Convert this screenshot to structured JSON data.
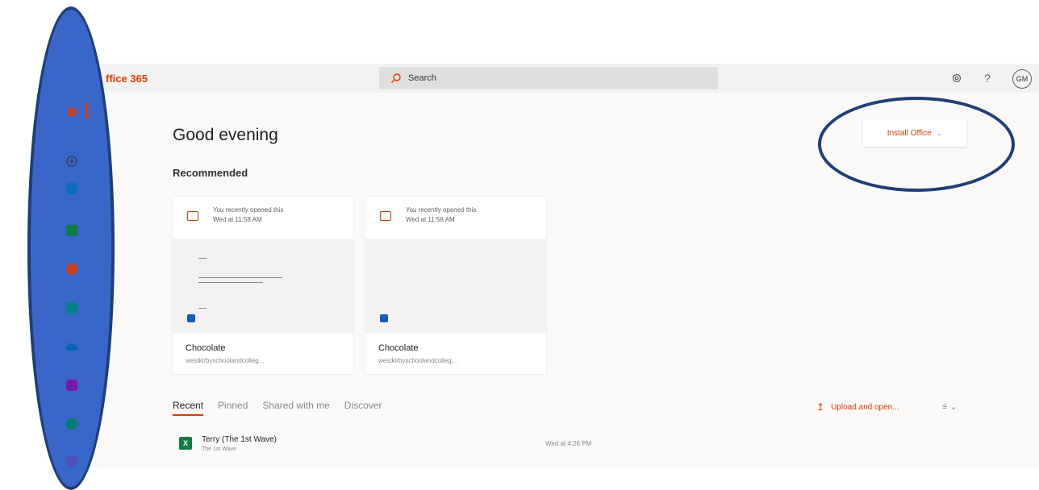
{
  "header": {
    "app_name": "ffice 365",
    "search_placeholder": "Search",
    "avatar_initials": "GM",
    "icons": [
      "waffle-icon",
      "search-icon",
      "gear-icon",
      "help-icon"
    ]
  },
  "rail": {
    "items": [
      {
        "name": "home-icon",
        "color": "#d83b01"
      },
      {
        "name": "create-icon",
        "color": "#605e5c"
      },
      {
        "name": "outlook-icon",
        "color": "#0f6cbd"
      },
      {
        "name": "excel-icon",
        "color": "#107c41"
      },
      {
        "name": "powerpoint-icon",
        "color": "#c43e1c"
      },
      {
        "name": "sharepoint-icon",
        "color": "#038387"
      },
      {
        "name": "onedrive-icon",
        "color": "#0364b8"
      },
      {
        "name": "onenote-icon",
        "color": "#7719aa"
      },
      {
        "name": "sway-icon",
        "color": "#008272"
      },
      {
        "name": "teams-icon",
        "color": "#4b53bc"
      }
    ]
  },
  "main": {
    "greeting": "Good evening",
    "recommended_title": "Recommended",
    "install_office": "Install Office",
    "cards": [
      {
        "line1": "You recently opened this",
        "line2": "Wed at 11:58 AM",
        "name": "Chocolate",
        "path": "westkirbyschoolandcolleg..."
      },
      {
        "line1": "You recently opened this",
        "line2": "Wed at 11:58 AM",
        "name": "Chocolate",
        "path": "westkirbyschoolandcolleg..."
      }
    ],
    "tabs": [
      "Recent",
      "Pinned",
      "Shared with me",
      "Discover"
    ],
    "upload_label": "Upload and open...",
    "files": [
      {
        "name": "Terry (The 1st Wave)",
        "subtitle": "The 1st Wave",
        "date": "Wed at 4:26 PM"
      }
    ]
  },
  "colors": {
    "accent": "#d83b01",
    "annotation_fill": "#3966c8",
    "annotation_stroke": "#1f3f76"
  }
}
